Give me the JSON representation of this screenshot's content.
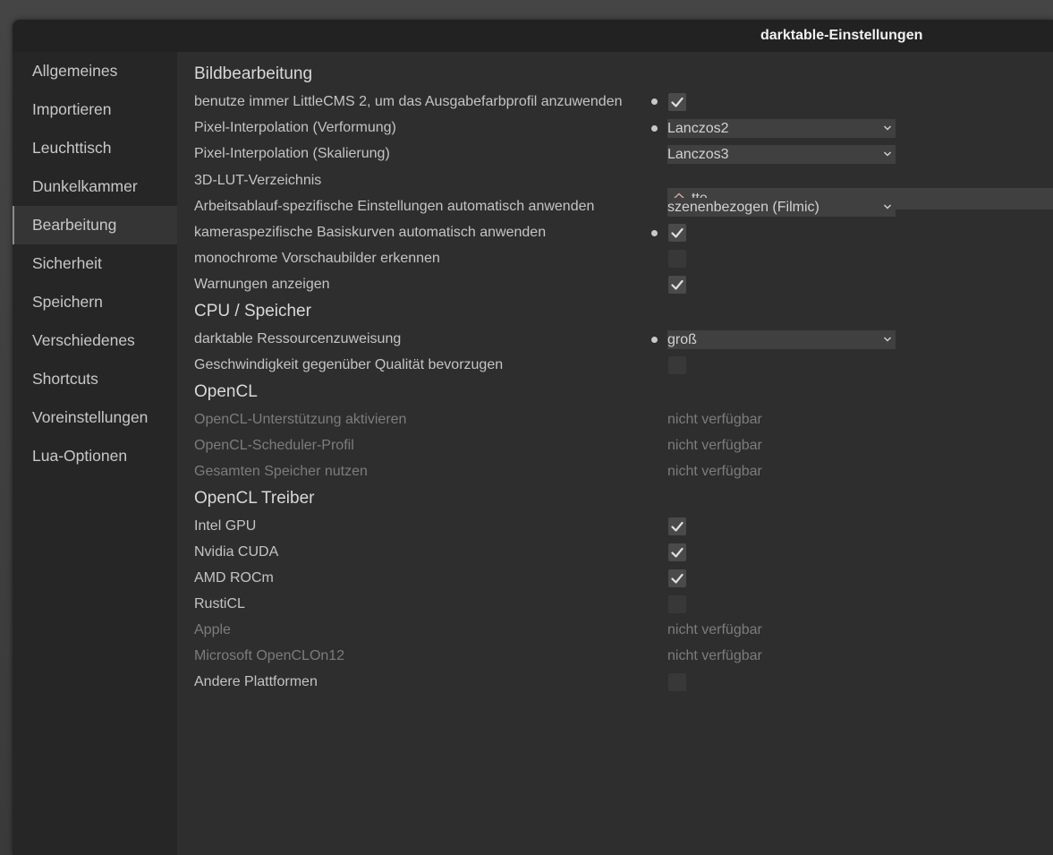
{
  "window": {
    "title": "darktable-Einstellungen"
  },
  "sidebar": {
    "items": [
      {
        "label": "Allgemeines"
      },
      {
        "label": "Importieren"
      },
      {
        "label": "Leuchttisch"
      },
      {
        "label": "Dunkelkammer"
      },
      {
        "label": "Bearbeitung",
        "active": true
      },
      {
        "label": "Sicherheit"
      },
      {
        "label": "Speichern"
      },
      {
        "label": "Verschiedenes"
      },
      {
        "label": "Shortcuts"
      },
      {
        "label": "Voreinstellungen"
      },
      {
        "label": "Lua-Optionen"
      }
    ]
  },
  "main": {
    "sections": [
      {
        "title": "Bildbearbeitung"
      },
      {
        "title": "CPU / Speicher"
      },
      {
        "title": "OpenCL"
      },
      {
        "title": "OpenCL Treiber"
      }
    ],
    "rows": [
      {
        "label": "benutze immer LittleCMS 2, um das Ausgabefarbprofil anzuwenden",
        "control": "checkbox",
        "checked": true,
        "modified": true
      },
      {
        "label": "Pixel-Interpolation (Verformung)",
        "control": "dropdown",
        "value": "Lanczos2",
        "modified": true
      },
      {
        "label": "Pixel-Interpolation (Skalierung)",
        "control": "dropdown",
        "value": "Lanczos3",
        "modified": false
      },
      {
        "label": "3D-LUT-Verzeichnis",
        "control": "path",
        "value": "tte",
        "icon": "home-icon"
      },
      {
        "label": "Arbeitsablauf-spezifische Einstellungen automatisch anwenden",
        "control": "dropdown",
        "value": "szenenbezogen (Filmic)",
        "modified": false
      },
      {
        "label": "kameraspezifische Basiskurven automatisch anwenden",
        "control": "checkbox",
        "checked": true,
        "modified": true
      },
      {
        "label": "monochrome Vorschaubilder erkennen",
        "control": "checkbox",
        "checked": false,
        "modified": false
      },
      {
        "label": "Warnungen anzeigen",
        "control": "checkbox",
        "checked": true,
        "modified": false
      },
      {
        "label": "darktable Ressourcenzuweisung",
        "control": "dropdown",
        "value": "groß",
        "modified": true
      },
      {
        "label": "Geschwindigkeit gegenüber Qualität bevorzugen",
        "control": "checkbox",
        "checked": false,
        "modified": false
      },
      {
        "label": "OpenCL-Unterstützung aktivieren",
        "control": "na",
        "value": "nicht verfügbar",
        "disabled": true
      },
      {
        "label": "OpenCL-Scheduler-Profil",
        "control": "na",
        "value": "nicht verfügbar",
        "disabled": true
      },
      {
        "label": "Gesamten Speicher nutzen",
        "control": "na",
        "value": "nicht verfügbar",
        "disabled": true
      },
      {
        "label": "Intel GPU",
        "control": "checkbox",
        "checked": true,
        "modified": false
      },
      {
        "label": "Nvidia CUDA",
        "control": "checkbox",
        "checked": true,
        "modified": false
      },
      {
        "label": "AMD ROCm",
        "control": "checkbox",
        "checked": true,
        "modified": false
      },
      {
        "label": "RustiCL",
        "control": "checkbox",
        "checked": false,
        "modified": false
      },
      {
        "label": "Apple",
        "control": "na",
        "value": "nicht verfügbar",
        "disabled": true
      },
      {
        "label": "Microsoft OpenCLOn12",
        "control": "na",
        "value": "nicht verfügbar",
        "disabled": true
      },
      {
        "label": "Andere Plattformen",
        "control": "checkbox",
        "checked": false,
        "modified": false
      }
    ]
  },
  "colors": {
    "window_bg": "#2e2e2e",
    "sidebar_bg": "#262626",
    "titlebar_bg": "#222222",
    "active_item_bg": "#353535",
    "text": "#c4c4c4",
    "disabled_text": "#7c7c7c"
  }
}
